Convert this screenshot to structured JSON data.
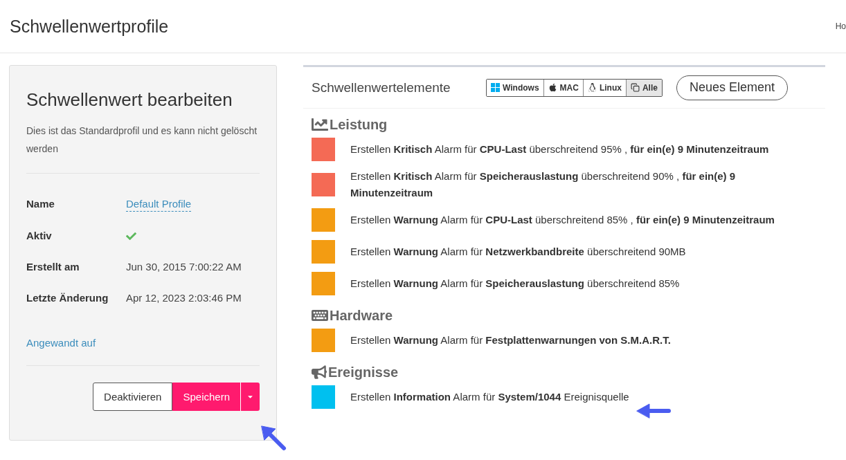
{
  "page": {
    "title": "Schwellenwertprofile",
    "breadcrumb": "Ho"
  },
  "editor": {
    "title": "Schwellenwert bearbeiten",
    "description": "Dies ist das Standardprofil und es kann nicht gelöscht werden",
    "fields": [
      {
        "label": "Name",
        "kind": "link",
        "value": "Default Profile"
      },
      {
        "label": "Aktiv",
        "kind": "check",
        "checked": true
      },
      {
        "label": "Erstellt am",
        "kind": "text",
        "value": "Jun 30, 2015 7:00:22 AM"
      },
      {
        "label": "Letzte Änderung",
        "kind": "text",
        "value": "Apr 12, 2023 2:03:46 PM"
      }
    ],
    "applied_link": "Angewandt auf",
    "deactivate_button": "Deaktivieren",
    "save_button": "Speichern"
  },
  "elements": {
    "title": "Schwellenwertelemente",
    "filters": [
      {
        "label": "Windows",
        "kind": "windows",
        "selected": false
      },
      {
        "label": "MAC",
        "kind": "apple",
        "selected": false
      },
      {
        "label": "Linux",
        "kind": "linux",
        "selected": false
      },
      {
        "label": "Alle",
        "kind": "all",
        "selected": true
      }
    ],
    "new_button": "Neues Element",
    "sections": [
      {
        "title": "Leistung",
        "kind": "performance",
        "items": [
          {
            "color": "#f46a55",
            "text": "Erstellen **Kritisch** Alarm für **CPU-Last** überschreitend 95% , **für ein(e) 9 Minutenzeitraum**"
          },
          {
            "color": "#f46a55",
            "text": "Erstellen **Kritisch** Alarm für **Speicherauslastung** überschreitend 90% , **für ein(e) 9 Minutenzeitraum**"
          },
          {
            "color": "#f39c12",
            "text": "Erstellen **Warnung** Alarm für **CPU-Last** überschreitend 85% , **für ein(e) 9 Minutenzeitraum**"
          },
          {
            "color": "#f39c12",
            "text": "Erstellen **Warnung** Alarm für **Netzwerkbandbreite** überschreitend 90MB"
          },
          {
            "color": "#f39c12",
            "text": "Erstellen **Warnung** Alarm für **Speicherauslastung** überschreitend 85%"
          }
        ]
      },
      {
        "title": "Hardware",
        "kind": "hardware",
        "items": [
          {
            "color": "#f39c12",
            "text": "Erstellen **Warnung** Alarm für **Festplattenwarnungen von S.M.A.R.T.**"
          }
        ]
      },
      {
        "title": "Ereignisse",
        "kind": "events",
        "items": [
          {
            "color": "#00c0ef",
            "text": "Erstellen **Information** Alarm für **System/1044** Ereignisquelle"
          }
        ]
      }
    ]
  }
}
